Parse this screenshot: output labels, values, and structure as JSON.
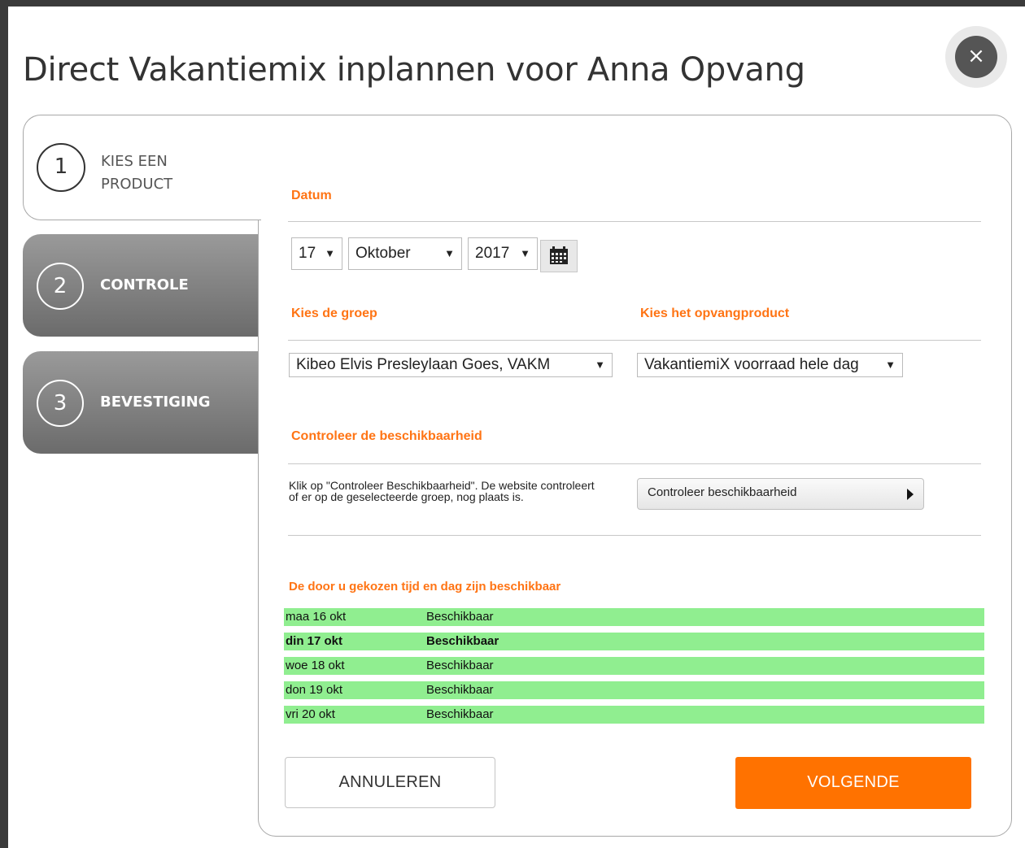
{
  "title": "Direct Vakantiemix inplannen voor Anna Opvang",
  "close_symbol": "×",
  "steps": [
    {
      "num": "1",
      "label": "KIES EEN PRODUCT"
    },
    {
      "num": "2",
      "label": "CONTROLE"
    },
    {
      "num": "3",
      "label": "BEVESTIGING"
    }
  ],
  "datum": {
    "heading": "Datum",
    "day": "17",
    "month": "Oktober",
    "year": "2017"
  },
  "groep": {
    "heading": "Kies de groep",
    "value": "Kibeo Elvis Presleylaan Goes, VAKM"
  },
  "product": {
    "heading": "Kies het opvangproduct",
    "value": "VakantiemiX voorraad hele dag"
  },
  "check": {
    "heading": "Controleer de beschikbaarheid",
    "description": "Klik op \"Controleer Beschikbaarheid\". De website controleert of er op de geselecteerde groep, nog plaats is.",
    "button": "Controleer beschikbaarheid"
  },
  "result": {
    "heading": "De door u gekozen tijd en dag zijn beschikbaar",
    "rows": [
      {
        "day": "maa 16 okt",
        "status": "Beschikbaar"
      },
      {
        "day": "din 17 okt",
        "status": "Beschikbaar"
      },
      {
        "day": "woe 18 okt",
        "status": "Beschikbaar"
      },
      {
        "day": "don 19 okt",
        "status": "Beschikbaar"
      },
      {
        "day": "vri 20 okt",
        "status": "Beschikbaar"
      }
    ]
  },
  "buttons": {
    "cancel": "ANNULEREN",
    "next": "VOLGENDE"
  },
  "colors": {
    "accent": "#ff7414",
    "available": "#90ee90",
    "primary_button": "#ff7200"
  }
}
